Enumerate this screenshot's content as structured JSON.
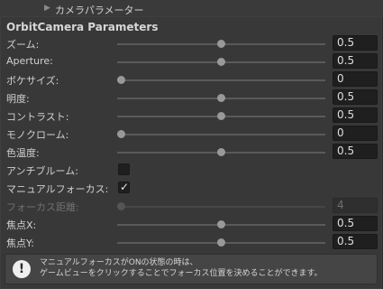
{
  "header": {
    "foldout_label": "カメラパラメーター"
  },
  "section": {
    "title": "OrbitCamera Parameters"
  },
  "parameters": [
    {
      "label": "ズーム:",
      "value": "0.5",
      "slider_fraction": 0.5,
      "disabled": false
    },
    {
      "label": "Aperture:",
      "value": "0.5",
      "slider_fraction": 0.5,
      "disabled": false
    },
    {
      "label": "ボケサイズ:",
      "value": "0",
      "slider_fraction": 0.0,
      "disabled": false
    },
    {
      "label": "明度:",
      "value": "0.5",
      "slider_fraction": 0.5,
      "disabled": false
    },
    {
      "label": "コントラスト:",
      "value": "0.5",
      "slider_fraction": 0.5,
      "disabled": false
    },
    {
      "label": "モノクローム:",
      "value": "0",
      "slider_fraction": 0.0,
      "disabled": false
    },
    {
      "label": "色温度:",
      "value": "0.5",
      "slider_fraction": 0.5,
      "disabled": false
    }
  ],
  "toggles": {
    "anti_bloom": {
      "label": "アンチブルーム:",
      "checked": false
    },
    "manual_focus": {
      "label": "マニュアルフォーカス:",
      "checked": true,
      "checkmark": "✓"
    }
  },
  "focus_distance": {
    "label": "フォーカス距離:",
    "value": "4",
    "slider_fraction": 0.0,
    "disabled": true
  },
  "focus_points": [
    {
      "label": "焦点X:",
      "value": "0.5",
      "slider_fraction": 0.5
    },
    {
      "label": "焦点Y:",
      "value": "0.5",
      "slider_fraction": 0.5
    }
  ],
  "help": {
    "icon": "!",
    "line1": "マニュアルフォーカスがONの状態の時は、",
    "line2": "ゲームビューをクリックすることでフォーカス位置を決めることができます。"
  }
}
